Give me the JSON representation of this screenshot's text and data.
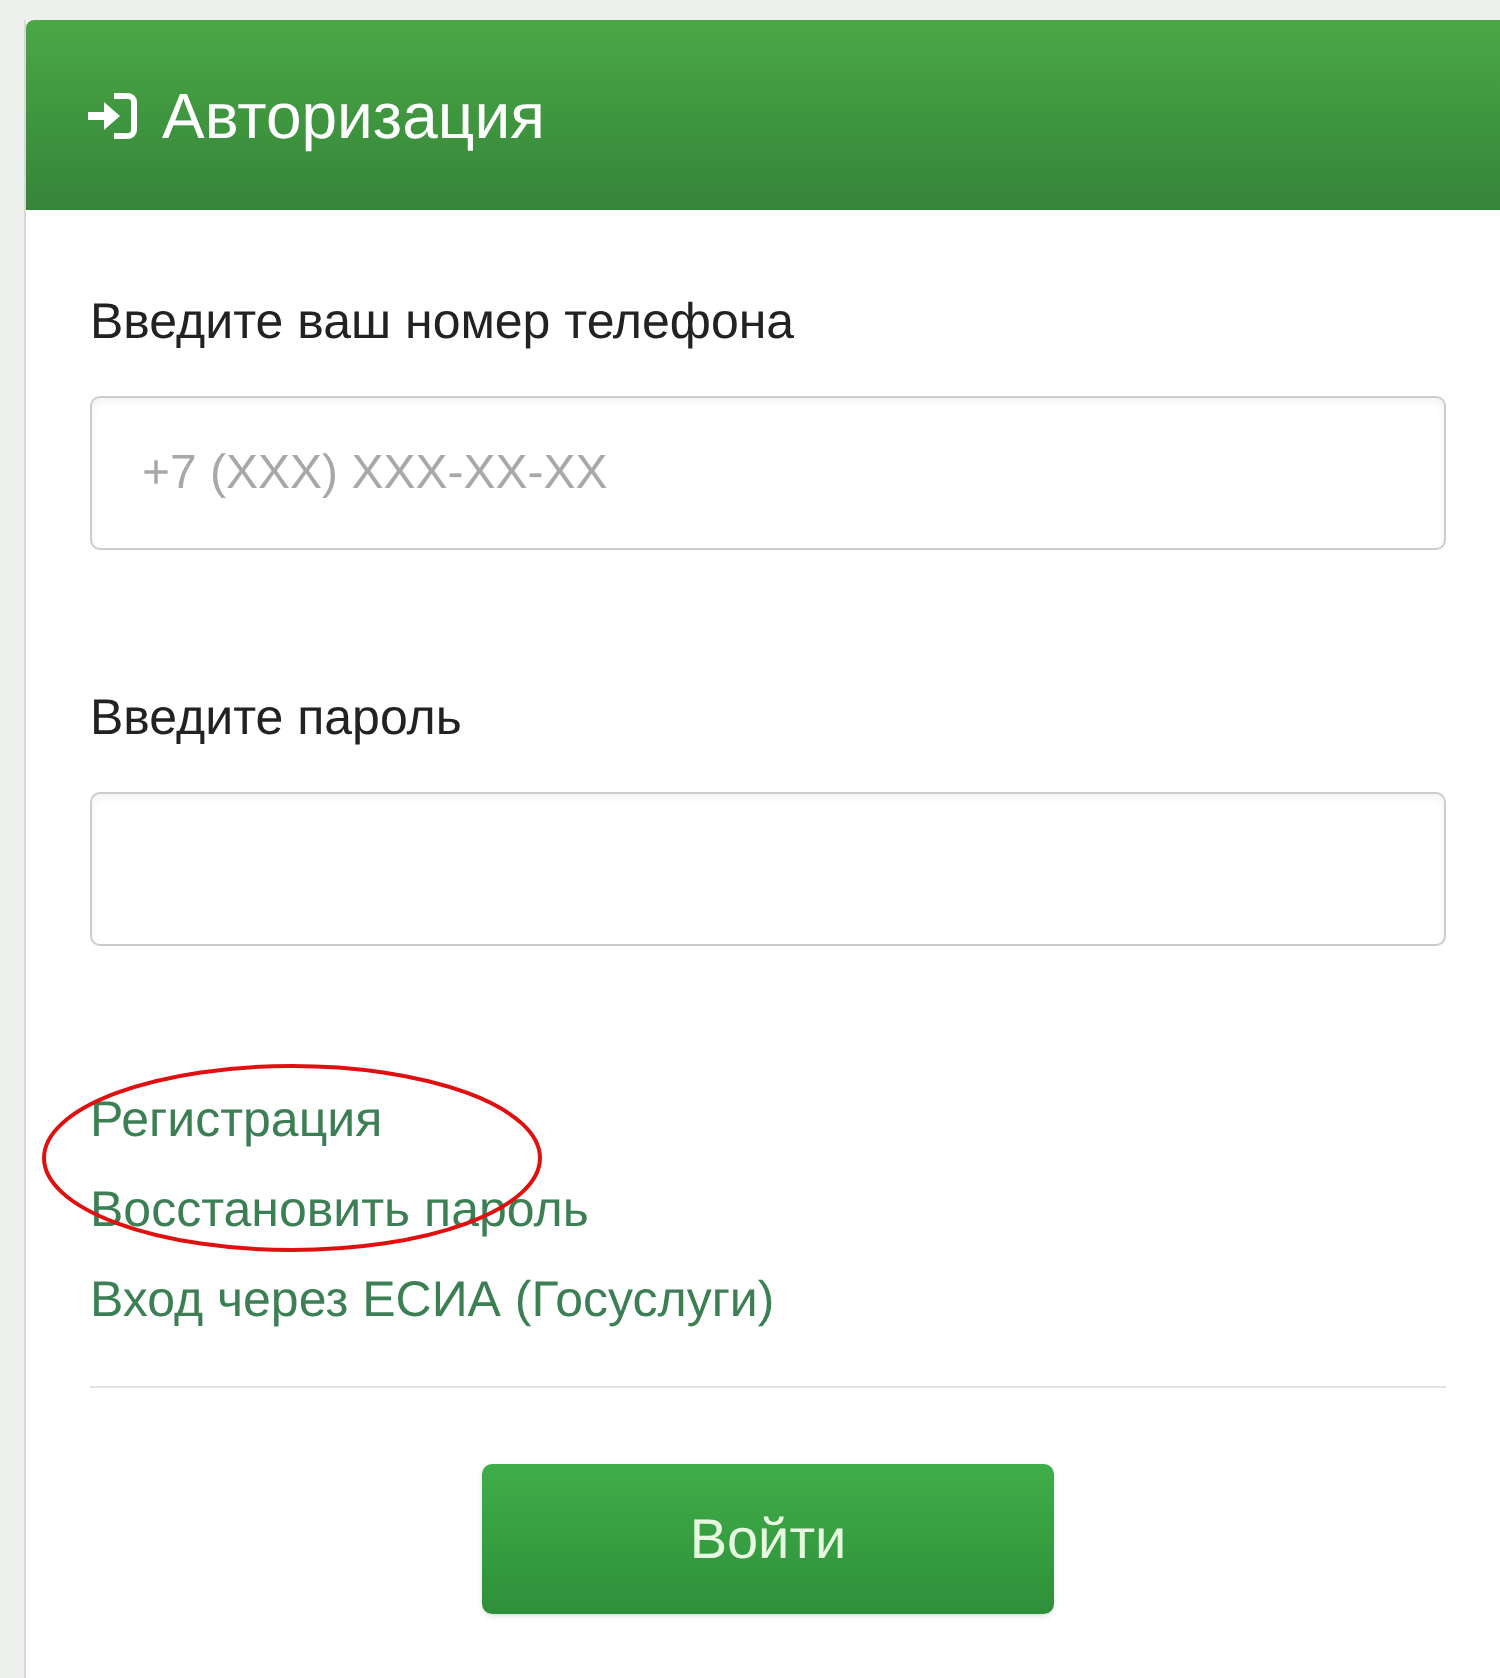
{
  "header": {
    "title": "Авторизация"
  },
  "fields": [
    {
      "label": "Введите ваш номер телефона",
      "placeholder": "+7 (XXX) XXX-XX-XX"
    },
    {
      "label": "Введите пароль"
    }
  ],
  "links": [
    "Регистрация",
    "Восстановить пароль",
    "Вход через ЕСИА (Госуслуги)"
  ],
  "submit": {
    "label": "Войти"
  }
}
